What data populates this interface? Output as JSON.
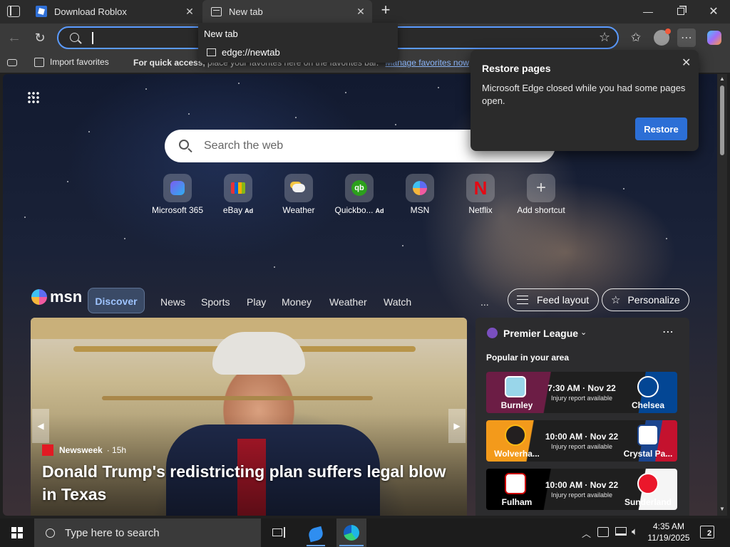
{
  "tabs": [
    {
      "title": "Download Roblox"
    },
    {
      "title": "New tab"
    }
  ],
  "tab_dropdown": {
    "title": "New tab",
    "url": "edge://newtab"
  },
  "favorites_bar": {
    "import_label": "Import favorites",
    "hint_bold": "For quick access,",
    "hint_rest": " place your favorites here on the favorites bar.",
    "manage_link": "Manage favorites now"
  },
  "search": {
    "placeholder": "Search the web"
  },
  "shortcuts": [
    {
      "label": "Microsoft 365",
      "ad": ""
    },
    {
      "label": "eBay",
      "ad": "Ad"
    },
    {
      "label": "Weather",
      "ad": ""
    },
    {
      "label": "Quickbo...",
      "ad": "Ad"
    },
    {
      "label": "MSN",
      "ad": ""
    },
    {
      "label": "Netflix",
      "ad": ""
    },
    {
      "label": "Add shortcut",
      "ad": ""
    }
  ],
  "msn": {
    "logo": "msn",
    "tabs": [
      "Discover",
      "News",
      "Sports",
      "Play",
      "Money",
      "Weather",
      "Watch"
    ],
    "more": "...",
    "feed_layout": "Feed layout",
    "personalize": "Personalize"
  },
  "hero": {
    "source": "Newsweek",
    "age": "· 15h",
    "headline": "Donald Trump's redistricting plan suffers legal blow in Texas"
  },
  "premier_league": {
    "title": "Premier League",
    "subtitle": "Popular in your area",
    "matches": [
      {
        "home": "Burnley",
        "away": "Chelsea",
        "time": "7:30 AM · Nov 22",
        "note": "Injury report available",
        "home_color": "#6c1d45",
        "away_color": "#034694"
      },
      {
        "home": "Wolverha...",
        "away": "Crystal Pa...",
        "time": "10:00 AM · Nov 22",
        "note": "Injury report available",
        "home_color": "#fdb913",
        "away_color": "#1b458f"
      },
      {
        "home": "Fulham",
        "away": "Sunderland",
        "time": "10:00 AM · Nov 22",
        "note": "Injury report available",
        "home_color": "#000000",
        "away_color": "#eb172b"
      }
    ]
  },
  "restore_popup": {
    "title": "Restore pages",
    "body": "Microsoft Edge closed while you had some pages open.",
    "button": "Restore"
  },
  "taskbar": {
    "search_placeholder": "Type here to search",
    "time": "4:35 AM",
    "date": "11/19/2025",
    "notification_count": "2"
  },
  "colors": {
    "accent": "#2c6fd6",
    "focus_ring": "#5b9bff"
  }
}
